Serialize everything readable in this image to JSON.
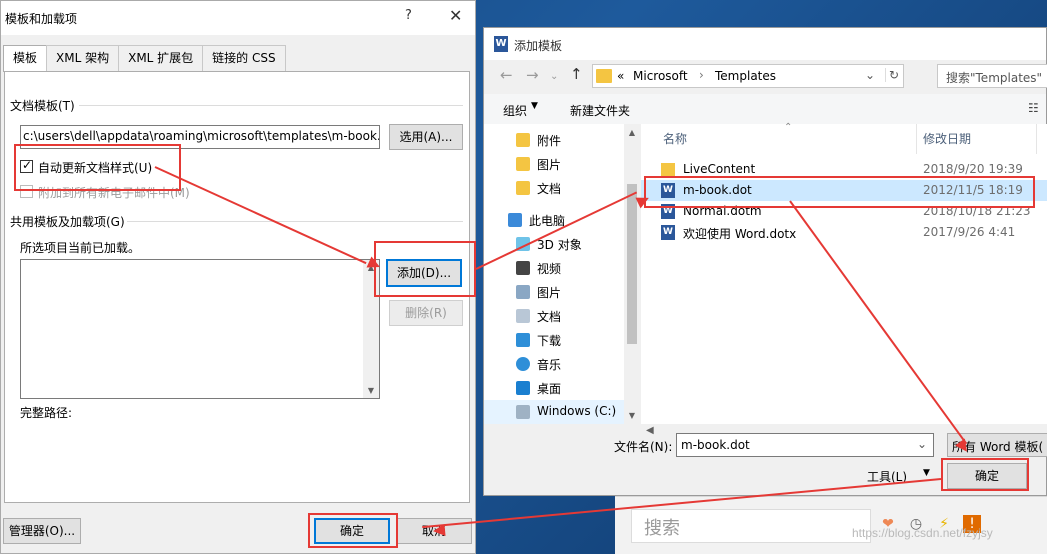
{
  "dialog1": {
    "title": "模板和加载项",
    "help": "?",
    "close": "✕",
    "tabs": [
      "模板",
      "XML 架构",
      "XML 扩展包",
      "链接的 CSS"
    ],
    "doc_template_label": "文档模板(T)",
    "doc_template_path": "c:\\users\\dell\\appdata\\roaming\\microsoft\\templates\\m-book.",
    "choose_button": "选用(A)...",
    "auto_update_label": "自动更新文档样式(U)",
    "attach_mail_label": "附加到所有新电子邮件中(M)",
    "global_templates_label": "共用模板及加载项(G)",
    "checked_items_label": "所选项目当前已加载。",
    "add_button": "添加(D)...",
    "remove_button": "删除(R)",
    "full_path_label": "完整路径:",
    "organizer_button": "管理器(O)...",
    "ok_button": "确定",
    "cancel_button": "取消"
  },
  "dialog2": {
    "title": "添加模板",
    "breadcrumb": {
      "prefix": "«",
      "parts": [
        "Microsoft",
        "Templates"
      ]
    },
    "search_placeholder": "搜索\"Templates\"",
    "organize": "组织",
    "new_folder": "新建文件夹",
    "nav_items": [
      {
        "label": "附件",
        "icon": "folder-icon"
      },
      {
        "label": "图片",
        "icon": "folder-icon"
      },
      {
        "label": "文档",
        "icon": "folder-icon"
      },
      {
        "label": "此电脑",
        "icon": "pc-icon"
      },
      {
        "label": "3D 对象",
        "icon": "3d-icon"
      },
      {
        "label": "视频",
        "icon": "video-icon"
      },
      {
        "label": "图片",
        "icon": "pictures-icon"
      },
      {
        "label": "文档",
        "icon": "documents-icon"
      },
      {
        "label": "下载",
        "icon": "download-icon"
      },
      {
        "label": "音乐",
        "icon": "music-icon"
      },
      {
        "label": "桌面",
        "icon": "desktop-icon"
      },
      {
        "label": "Windows (C:)",
        "icon": "drive-icon"
      }
    ],
    "columns": {
      "name": "名称",
      "date": "修改日期"
    },
    "files": [
      {
        "name": "LiveContent",
        "date": "2018/9/20 19:39",
        "type": "folder",
        "selected": false
      },
      {
        "name": "m-book.dot",
        "date": "2012/11/5 18:19",
        "type": "word",
        "selected": true
      },
      {
        "name": "Normal.dotm",
        "date": "2018/10/18 21:23",
        "type": "word",
        "selected": false
      },
      {
        "name": "欢迎使用 Word.dotx",
        "date": "2017/9/26 4:41",
        "type": "word",
        "selected": false
      }
    ],
    "filename_label": "文件名(N):",
    "filename_value": "m-book.dot",
    "filetype_value": "所有 Word 模板(",
    "tools": "工具(L)",
    "ok_button": "确定"
  },
  "background": {
    "search_placeholder": "搜索",
    "watermark": "https://blog.csdn.net/fzyjsy"
  },
  "colors": {
    "highlight": "#e53935",
    "selection": "#cce8ff",
    "accent": "#0078d7",
    "word": "#2b579a",
    "folder": "#f4c542"
  }
}
